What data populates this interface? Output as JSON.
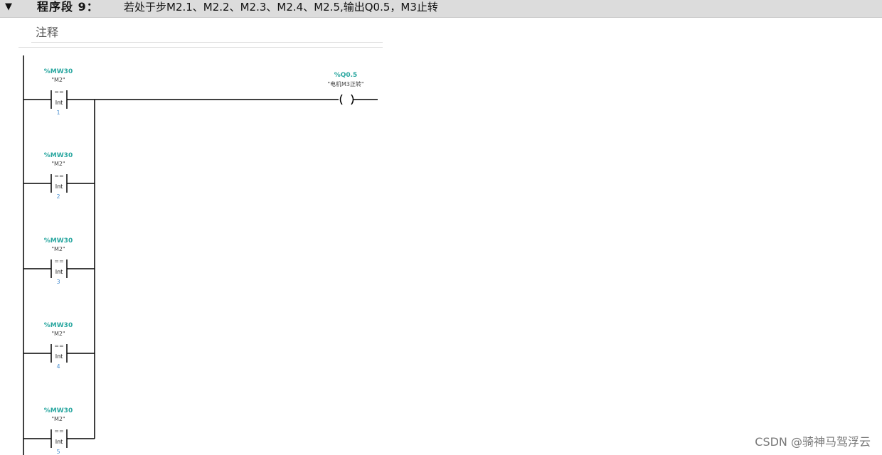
{
  "network": {
    "toggle_icon": "▼",
    "title": "程序段 9：",
    "description": "若处于步M2.1、M2.2、M2.3、M2.4、M2.5,输出Q0.5，M3止转",
    "comment_placeholder": "注释"
  },
  "contacts": [
    {
      "address": "%MW30",
      "symbol": "\"M2\"",
      "operator": "==",
      "type": "Int",
      "value": "1"
    },
    {
      "address": "%MW30",
      "symbol": "\"M2\"",
      "operator": "==",
      "type": "Int",
      "value": "2"
    },
    {
      "address": "%MW30",
      "symbol": "\"M2\"",
      "operator": "==",
      "type": "Int",
      "value": "3"
    },
    {
      "address": "%MW30",
      "symbol": "\"M2\"",
      "operator": "==",
      "type": "Int",
      "value": "4"
    },
    {
      "address": "%MW30",
      "symbol": "\"M2\"",
      "operator": "==",
      "type": "Int",
      "value": "5"
    }
  ],
  "coil": {
    "address": "%Q0.5",
    "symbol": "\"电机M3正转\""
  },
  "watermark": "CSDN @骑神马驾浮云",
  "colors": {
    "address": "#2aa7a0",
    "value": "#4a8fd0",
    "line": "#000000"
  }
}
